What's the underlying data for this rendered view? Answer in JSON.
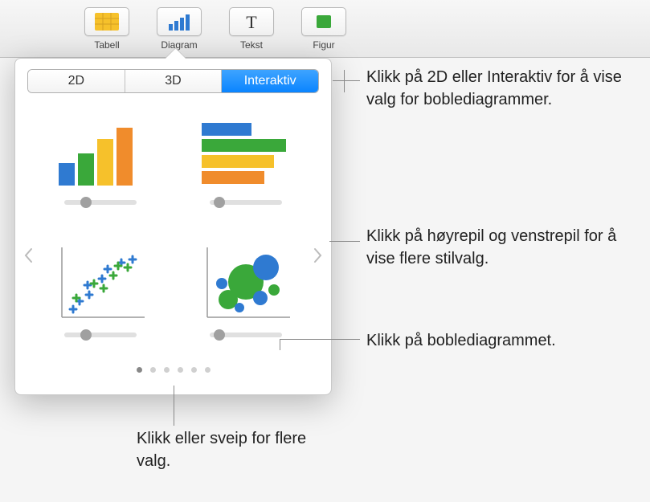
{
  "toolbar": {
    "items": [
      {
        "label": "Tabell",
        "icon": "table"
      },
      {
        "label": "Diagram",
        "icon": "chart"
      },
      {
        "label": "Tekst",
        "icon": "text"
      },
      {
        "label": "Figur",
        "icon": "shape"
      }
    ]
  },
  "popover": {
    "segments": [
      "2D",
      "3D",
      "Interaktiv"
    ],
    "active_segment_index": 2,
    "charts": [
      {
        "name": "column-chart"
      },
      {
        "name": "bar-chart"
      },
      {
        "name": "scatter-chart"
      },
      {
        "name": "bubble-chart"
      }
    ],
    "page_count": 6,
    "active_page_index": 0
  },
  "callouts": {
    "top": "Klikk på 2D eller Interaktiv for å vise valg for boblediagrammer.",
    "arrows": "Klikk på høyrepil og venstrepil for å vise flere stilvalg.",
    "bubble": "Klikk på boblediagrammet.",
    "dots": "Klikk eller sveip for flere valg."
  },
  "colors": {
    "chart_palette": [
      "#2f7ad1",
      "#3aa83a",
      "#f6c12b",
      "#f08c2c"
    ]
  }
}
